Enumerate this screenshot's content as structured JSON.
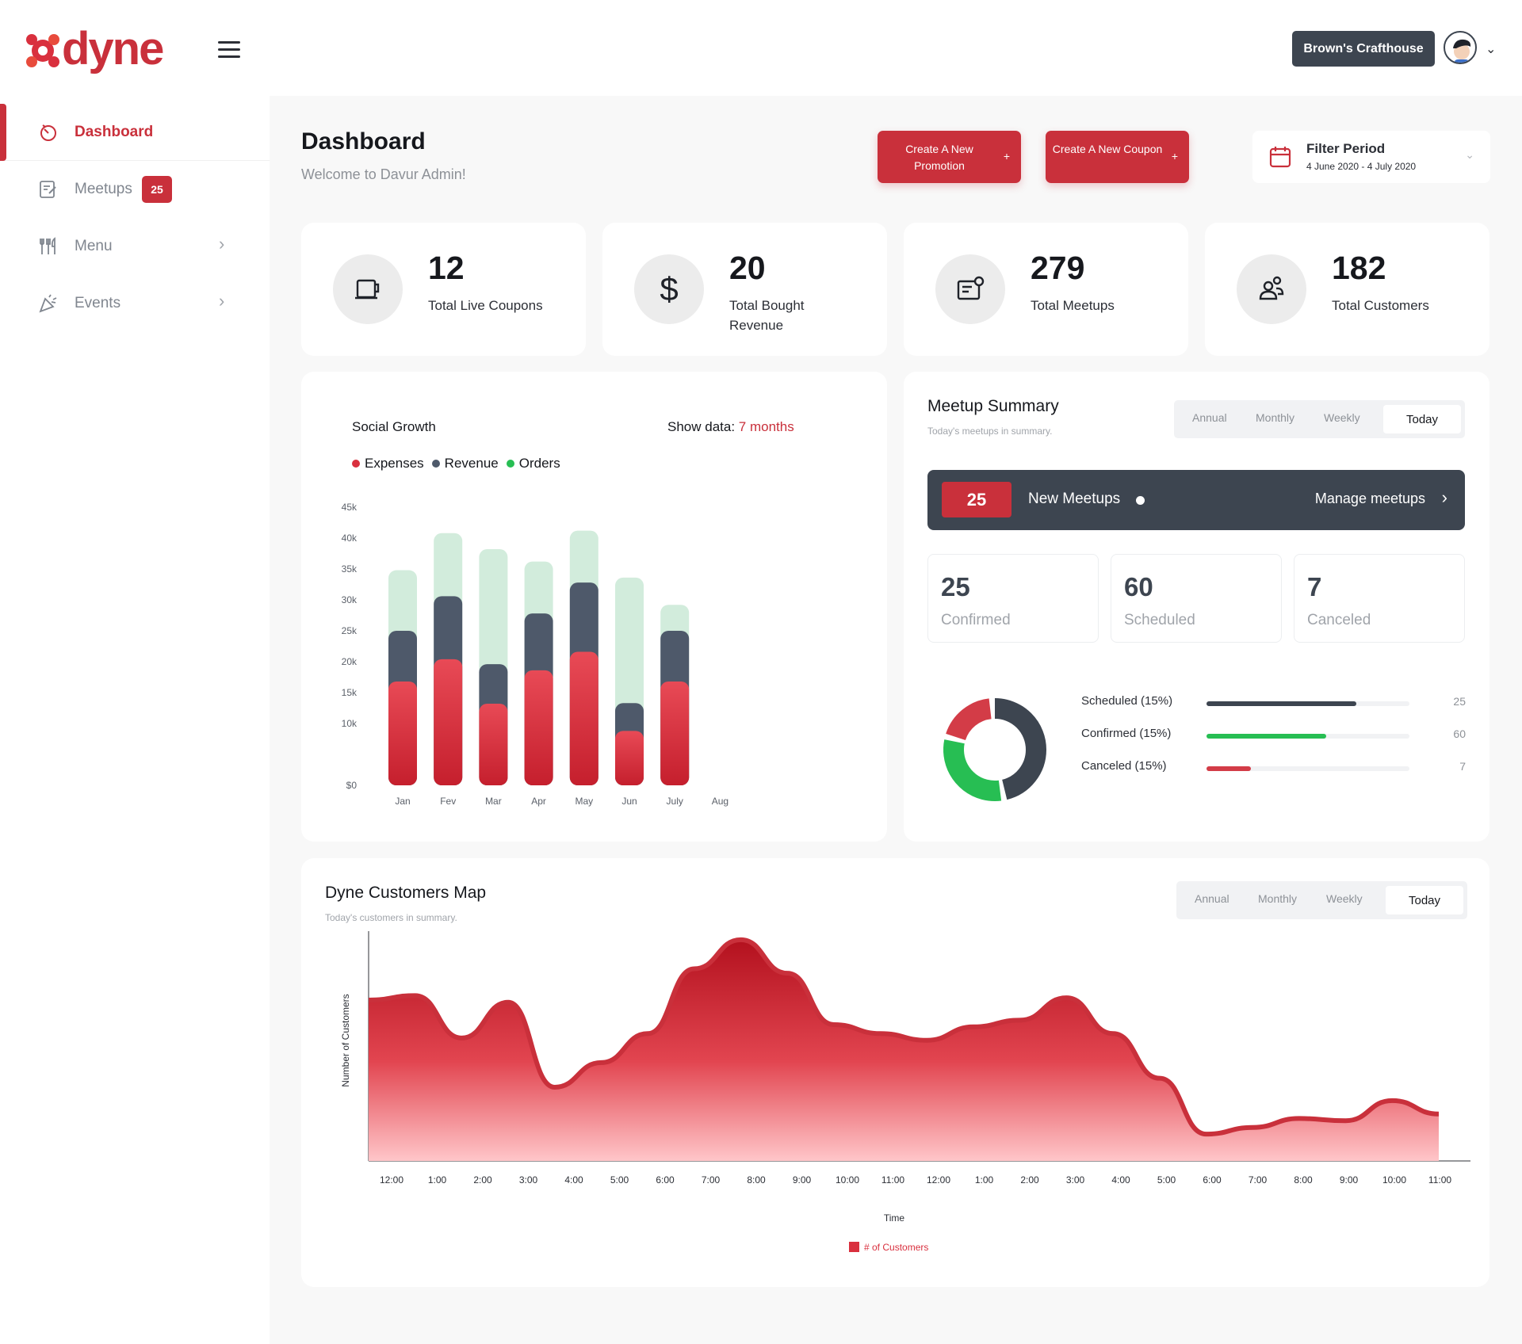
{
  "brand": {
    "name": "dyne",
    "accent": "#c9303b",
    "dark": "#3d4550"
  },
  "topbar": {
    "shop_label": "Brown's Crafthouse"
  },
  "sidebar": {
    "items": [
      {
        "label": "Dashboard",
        "icon": "dashboard-icon",
        "active": true
      },
      {
        "label": "Meetups",
        "icon": "meetups-icon",
        "badge": "25"
      },
      {
        "label": "Menu",
        "icon": "menu-icon"
      },
      {
        "label": "Events",
        "icon": "events-icon"
      }
    ]
  },
  "header": {
    "title": "Dashboard",
    "subtitle": "Welcome to Davur Admin!",
    "buttons": {
      "promotion": {
        "label": "Create A New Promotion",
        "icon": "+"
      },
      "coupon": {
        "label": "Create A New Coupon",
        "icon": "+"
      }
    },
    "filter": {
      "title": "Filter Period",
      "dates": "4 June 2020 - 4 July 2020"
    }
  },
  "stats": [
    {
      "value": "12",
      "label": "Total Live Coupons",
      "icon": "coupon-icon"
    },
    {
      "value": "20",
      "label": "Total Bought Revenue",
      "icon": "dollar-icon"
    },
    {
      "value": "279",
      "label": "Total Meetups",
      "icon": "meetup-board-icon"
    },
    {
      "value": "182",
      "label": "Total Customers",
      "icon": "customers-icon"
    }
  ],
  "social_growth": {
    "title": "Social Growth",
    "show_label": "Show data:",
    "show_value": "7 months"
  },
  "meetup_summary": {
    "title": "Meetup Summary",
    "subtitle": "Today's meetups in summary.",
    "periods": [
      "Annual",
      "Monthly",
      "Weekly",
      "Today"
    ],
    "selected_period": "Today",
    "new_meetups": {
      "count": "25",
      "label": "New Meetups",
      "link": "Manage meetups"
    },
    "boxes": [
      {
        "value": "25",
        "label": "Confirmed"
      },
      {
        "value": "60",
        "label": "Scheduled"
      },
      {
        "value": "7",
        "label": "Canceled"
      }
    ],
    "progress": [
      {
        "label": "Scheduled (15%)",
        "value": "25",
        "fraction": 0.74,
        "color": "#3d4550"
      },
      {
        "label": "Confirmed (15%)",
        "value": "60",
        "fraction": 0.59,
        "color": "#27be53"
      },
      {
        "label": "Canceled (15%)",
        "value": "7",
        "fraction": 0.22,
        "color": "#d33c47"
      }
    ]
  },
  "customers_map": {
    "title": "Dyne Customers Map",
    "subtitle": "Today's customers in summary.",
    "periods": [
      "Annual",
      "Monthly",
      "Weekly",
      "Today"
    ],
    "selected_period": "Today"
  },
  "chart_data": [
    {
      "type": "bar",
      "stacked": true,
      "categories": [
        "Jan",
        "Fev",
        "Mar",
        "Apr",
        "May",
        "Jun",
        "July",
        "Aug"
      ],
      "series": [
        {
          "name": "Expenses",
          "color": "#d9303e",
          "values": [
            16800,
            20400,
            13200,
            18600,
            21600,
            8800,
            16800,
            0
          ]
        },
        {
          "name": "Revenue",
          "color": "#4e596a",
          "values": [
            8200,
            10200,
            6400,
            9200,
            11200,
            4500,
            8200,
            0
          ]
        },
        {
          "name": "Orders",
          "color": "#d2ecdc",
          "values": [
            9800,
            10200,
            18600,
            8400,
            8400,
            20300,
            4200,
            0
          ]
        }
      ],
      "yticks": [
        "$0",
        "10k",
        "15k",
        "20k",
        "25k",
        "30k",
        "35k",
        "40k",
        "45k"
      ],
      "ylim": [
        0,
        45000
      ],
      "legend": "top-left"
    },
    {
      "type": "pie",
      "donut": true,
      "series": [
        {
          "name": "Scheduled",
          "value": 25,
          "color": "#3d4550"
        },
        {
          "name": "Confirmed",
          "value": 60,
          "color": "#27be53"
        },
        {
          "name": "Canceled",
          "value": 7,
          "color": "#d33c47"
        }
      ]
    },
    {
      "type": "area",
      "xlabel": "Time",
      "ylabel": "Number of Customers",
      "legend": "# of Customers",
      "color": "#d9303e",
      "x": [
        "12:00",
        "1:00",
        "2:00",
        "3:00",
        "4:00",
        "5:00",
        "6:00",
        "7:00",
        "8:00",
        "9:00",
        "10:00",
        "11:00",
        "12:00",
        "1:00",
        "2:00",
        "3:00",
        "4:00",
        "5:00",
        "6:00",
        "7:00",
        "8:00",
        "9:00",
        "10:00",
        "11:00"
      ],
      "y": [
        72,
        74,
        55,
        71,
        33,
        44,
        57,
        86,
        99,
        84,
        61,
        57,
        54,
        60,
        63,
        73,
        57,
        37,
        12,
        15,
        19,
        18,
        27,
        21
      ]
    }
  ]
}
